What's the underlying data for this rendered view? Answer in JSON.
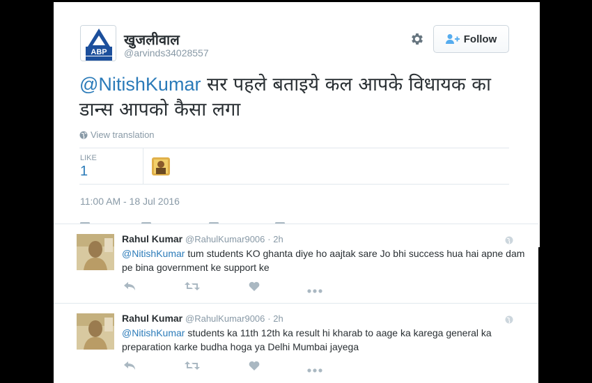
{
  "tweet": {
    "display_name": "खुजलीवाल",
    "handle": "@arvinds34028557",
    "avatar_text": "ABP",
    "follow_label": "Follow",
    "mention": "@NitishKumar",
    "text": " सर पहले बताइये कल आपके विधायक का डान्स आपको कैसा लगा",
    "translate_label": "View translation",
    "like_label": "LIKE",
    "like_count": "1",
    "timestamp": "11:00 AM - 18 Jul 2016"
  },
  "replies": [
    {
      "name": "Rahul Kumar",
      "handle": "@RahulKumar9006",
      "time": "· 2h",
      "mention": "@NitishKumar",
      "text": " tum students KO ghanta diye ho aajtak sare  Jo bhi success hua hai apne dam pe  bina government ke support ke"
    },
    {
      "name": "Rahul Kumar",
      "handle": "@RahulKumar9006",
      "time": "· 2h",
      "mention": "@NitishKumar",
      "text": " students ka 11th 12th ka result hi kharab to aage ka karega general ka preparation karke budha  hoga ya Delhi Mumbai jayega"
    }
  ],
  "colors": {
    "link": "#2b7bb9",
    "secondary_text": "#8899a6",
    "border": "#e1e8ed",
    "background": "#000000"
  },
  "icons": [
    "gear-icon",
    "follow-person-icon",
    "globe-icon",
    "reply-icon",
    "retweet-icon",
    "heart-icon",
    "more-icon"
  ]
}
